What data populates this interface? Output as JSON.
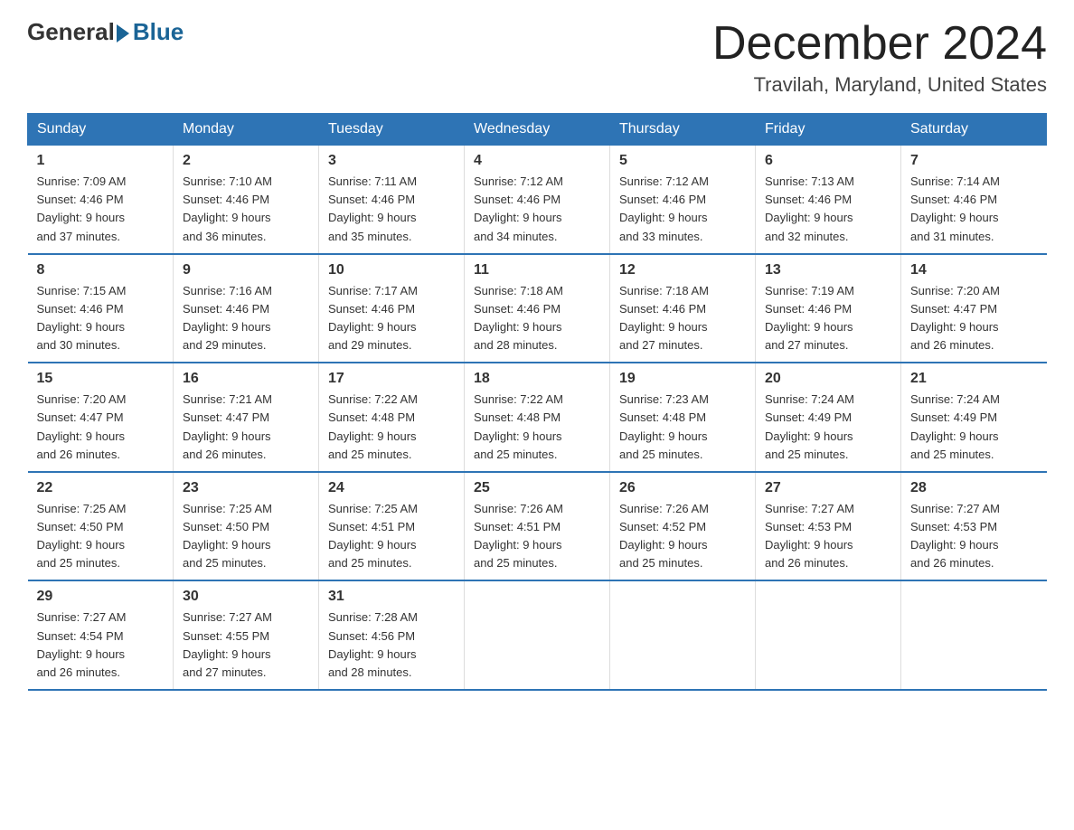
{
  "logo": {
    "general": "General",
    "blue": "Blue"
  },
  "header": {
    "month_title": "December 2024",
    "location": "Travilah, Maryland, United States"
  },
  "days_of_week": [
    "Sunday",
    "Monday",
    "Tuesday",
    "Wednesday",
    "Thursday",
    "Friday",
    "Saturday"
  ],
  "weeks": [
    [
      {
        "day": "1",
        "sunrise": "7:09 AM",
        "sunset": "4:46 PM",
        "daylight": "9 hours and 37 minutes."
      },
      {
        "day": "2",
        "sunrise": "7:10 AM",
        "sunset": "4:46 PM",
        "daylight": "9 hours and 36 minutes."
      },
      {
        "day": "3",
        "sunrise": "7:11 AM",
        "sunset": "4:46 PM",
        "daylight": "9 hours and 35 minutes."
      },
      {
        "day": "4",
        "sunrise": "7:12 AM",
        "sunset": "4:46 PM",
        "daylight": "9 hours and 34 minutes."
      },
      {
        "day": "5",
        "sunrise": "7:12 AM",
        "sunset": "4:46 PM",
        "daylight": "9 hours and 33 minutes."
      },
      {
        "day": "6",
        "sunrise": "7:13 AM",
        "sunset": "4:46 PM",
        "daylight": "9 hours and 32 minutes."
      },
      {
        "day": "7",
        "sunrise": "7:14 AM",
        "sunset": "4:46 PM",
        "daylight": "9 hours and 31 minutes."
      }
    ],
    [
      {
        "day": "8",
        "sunrise": "7:15 AM",
        "sunset": "4:46 PM",
        "daylight": "9 hours and 30 minutes."
      },
      {
        "day": "9",
        "sunrise": "7:16 AM",
        "sunset": "4:46 PM",
        "daylight": "9 hours and 29 minutes."
      },
      {
        "day": "10",
        "sunrise": "7:17 AM",
        "sunset": "4:46 PM",
        "daylight": "9 hours and 29 minutes."
      },
      {
        "day": "11",
        "sunrise": "7:18 AM",
        "sunset": "4:46 PM",
        "daylight": "9 hours and 28 minutes."
      },
      {
        "day": "12",
        "sunrise": "7:18 AM",
        "sunset": "4:46 PM",
        "daylight": "9 hours and 27 minutes."
      },
      {
        "day": "13",
        "sunrise": "7:19 AM",
        "sunset": "4:46 PM",
        "daylight": "9 hours and 27 minutes."
      },
      {
        "day": "14",
        "sunrise": "7:20 AM",
        "sunset": "4:47 PM",
        "daylight": "9 hours and 26 minutes."
      }
    ],
    [
      {
        "day": "15",
        "sunrise": "7:20 AM",
        "sunset": "4:47 PM",
        "daylight": "9 hours and 26 minutes."
      },
      {
        "day": "16",
        "sunrise": "7:21 AM",
        "sunset": "4:47 PM",
        "daylight": "9 hours and 26 minutes."
      },
      {
        "day": "17",
        "sunrise": "7:22 AM",
        "sunset": "4:48 PM",
        "daylight": "9 hours and 25 minutes."
      },
      {
        "day": "18",
        "sunrise": "7:22 AM",
        "sunset": "4:48 PM",
        "daylight": "9 hours and 25 minutes."
      },
      {
        "day": "19",
        "sunrise": "7:23 AM",
        "sunset": "4:48 PM",
        "daylight": "9 hours and 25 minutes."
      },
      {
        "day": "20",
        "sunrise": "7:24 AM",
        "sunset": "4:49 PM",
        "daylight": "9 hours and 25 minutes."
      },
      {
        "day": "21",
        "sunrise": "7:24 AM",
        "sunset": "4:49 PM",
        "daylight": "9 hours and 25 minutes."
      }
    ],
    [
      {
        "day": "22",
        "sunrise": "7:25 AM",
        "sunset": "4:50 PM",
        "daylight": "9 hours and 25 minutes."
      },
      {
        "day": "23",
        "sunrise": "7:25 AM",
        "sunset": "4:50 PM",
        "daylight": "9 hours and 25 minutes."
      },
      {
        "day": "24",
        "sunrise": "7:25 AM",
        "sunset": "4:51 PM",
        "daylight": "9 hours and 25 minutes."
      },
      {
        "day": "25",
        "sunrise": "7:26 AM",
        "sunset": "4:51 PM",
        "daylight": "9 hours and 25 minutes."
      },
      {
        "day": "26",
        "sunrise": "7:26 AM",
        "sunset": "4:52 PM",
        "daylight": "9 hours and 25 minutes."
      },
      {
        "day": "27",
        "sunrise": "7:27 AM",
        "sunset": "4:53 PM",
        "daylight": "9 hours and 26 minutes."
      },
      {
        "day": "28",
        "sunrise": "7:27 AM",
        "sunset": "4:53 PM",
        "daylight": "9 hours and 26 minutes."
      }
    ],
    [
      {
        "day": "29",
        "sunrise": "7:27 AM",
        "sunset": "4:54 PM",
        "daylight": "9 hours and 26 minutes."
      },
      {
        "day": "30",
        "sunrise": "7:27 AM",
        "sunset": "4:55 PM",
        "daylight": "9 hours and 27 minutes."
      },
      {
        "day": "31",
        "sunrise": "7:28 AM",
        "sunset": "4:56 PM",
        "daylight": "9 hours and 28 minutes."
      },
      null,
      null,
      null,
      null
    ]
  ],
  "labels": {
    "sunrise": "Sunrise:",
    "sunset": "Sunset:",
    "daylight": "Daylight:"
  }
}
